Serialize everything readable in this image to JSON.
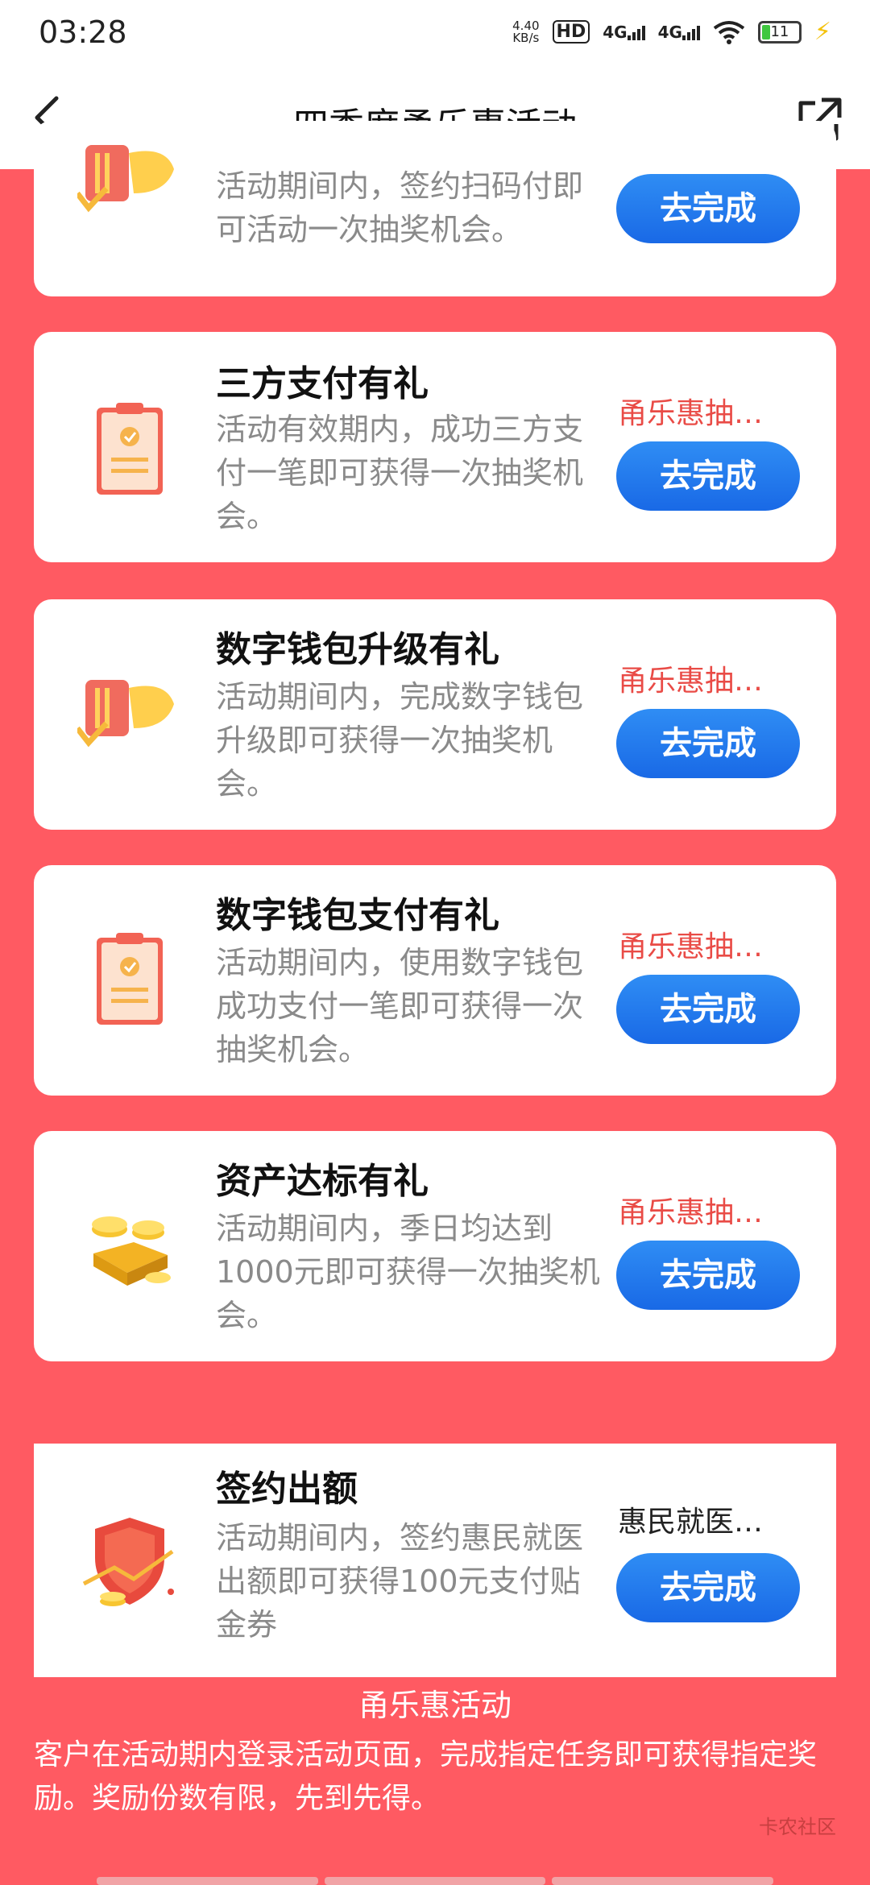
{
  "status": {
    "time": "03:28",
    "speed_value": "4.40",
    "speed_unit": "KB/s",
    "hd": "HD",
    "net1": "4G",
    "net2": "4G",
    "battery": "11"
  },
  "header": {
    "title": "四季度甬乐惠活动"
  },
  "tasks": [
    {
      "title": "",
      "desc": "活动期间内，签约扫码付即可活动一次抽奖机会。",
      "tag": "",
      "button": "去完成",
      "icon": "card-coupon-icon"
    },
    {
      "title": "三方支付有礼",
      "desc": "活动有效期内，成功三方支付一笔即可获得一次抽奖机会。",
      "tag": "甬乐惠抽…",
      "button": "去完成",
      "icon": "clipboard-icon"
    },
    {
      "title": "数字钱包升级有礼",
      "desc": "活动期间内，完成数字钱包升级即可获得一次抽奖机会。",
      "tag": "甬乐惠抽…",
      "button": "去完成",
      "icon": "card-coupon-icon"
    },
    {
      "title": "数字钱包支付有礼",
      "desc": "活动期间内，使用数字钱包成功支付一笔即可获得一次抽奖机会。",
      "tag": "甬乐惠抽…",
      "button": "去完成",
      "icon": "clipboard-icon"
    },
    {
      "title": "资产达标有礼",
      "desc": "活动期间内，季日均达到1000元即可获得一次抽奖机会。",
      "tag": "甬乐惠抽…",
      "button": "去完成",
      "icon": "gold-coins-icon"
    },
    {
      "title": "签约出额",
      "desc": "活动期间内，签约惠民就医出额即可获得100元支付贴金券",
      "tag": "惠民就医…",
      "button": "去完成",
      "icon": "shield-coins-icon"
    }
  ],
  "footer": {
    "title": "甬乐惠活动",
    "text": "客户在活动期内登录活动页面，完成指定任务即可获得指定奖励。奖励份数有限，先到先得。",
    "watermark": "卡农社区"
  },
  "colors": {
    "page_bg": "#ff5a62",
    "button": "#1f78ec",
    "tag_red": "#e94b46",
    "tag_dark": "#222222"
  }
}
